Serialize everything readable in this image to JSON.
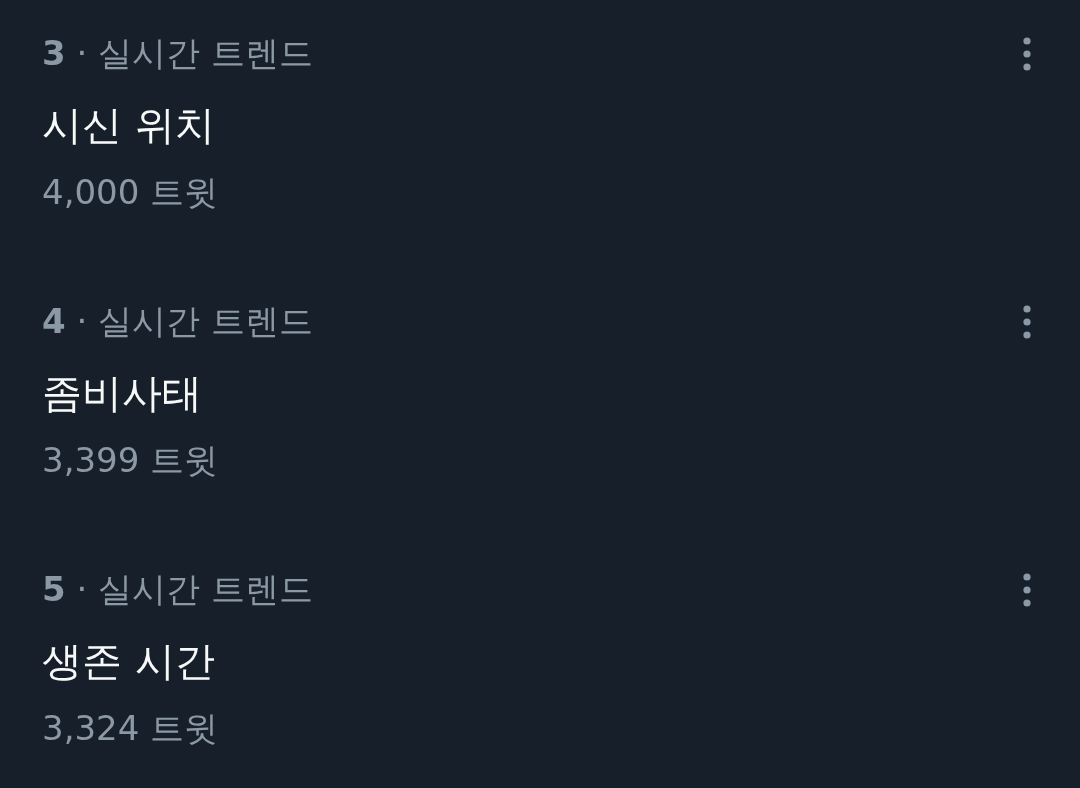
{
  "trends": [
    {
      "context": "**3** · 실시간 트렌드",
      "title": "시신 위치",
      "count": "4,000 트윗"
    },
    {
      "context": "**4** · 실시간 트렌드",
      "title": "좀비사태",
      "count": "3,399 트윗"
    },
    {
      "context": "**5** · 실시간 트렌드",
      "title": "생존 시간",
      "count": "3,324 트윗"
    }
  ]
}
